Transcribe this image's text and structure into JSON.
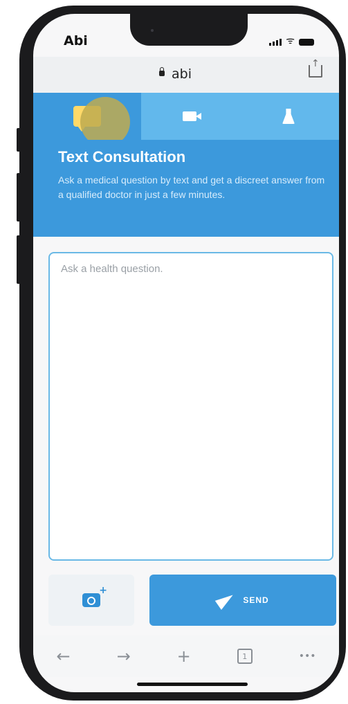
{
  "status": {
    "carrier": "Abi"
  },
  "browser": {
    "url": "abi",
    "tab_count": "1"
  },
  "tabs": [
    {
      "name": "text",
      "icon": "chat-bubble-icon"
    },
    {
      "name": "video",
      "icon": "video-camera-icon"
    },
    {
      "name": "lab",
      "icon": "flask-icon"
    }
  ],
  "header": {
    "title": "Text Consultation",
    "description": "Ask a medical question by text and get a discreet answer from a qualified doctor in just a few minutes."
  },
  "form": {
    "placeholder": "Ask a health question."
  },
  "actions": {
    "send_label": "SEND"
  },
  "nav": {
    "back": "←",
    "forward": "→",
    "add": "+",
    "more": "•••"
  },
  "colors": {
    "primary": "#3c99dc",
    "tab_light": "#62b8ec",
    "chat_icon": "#ffd969"
  }
}
